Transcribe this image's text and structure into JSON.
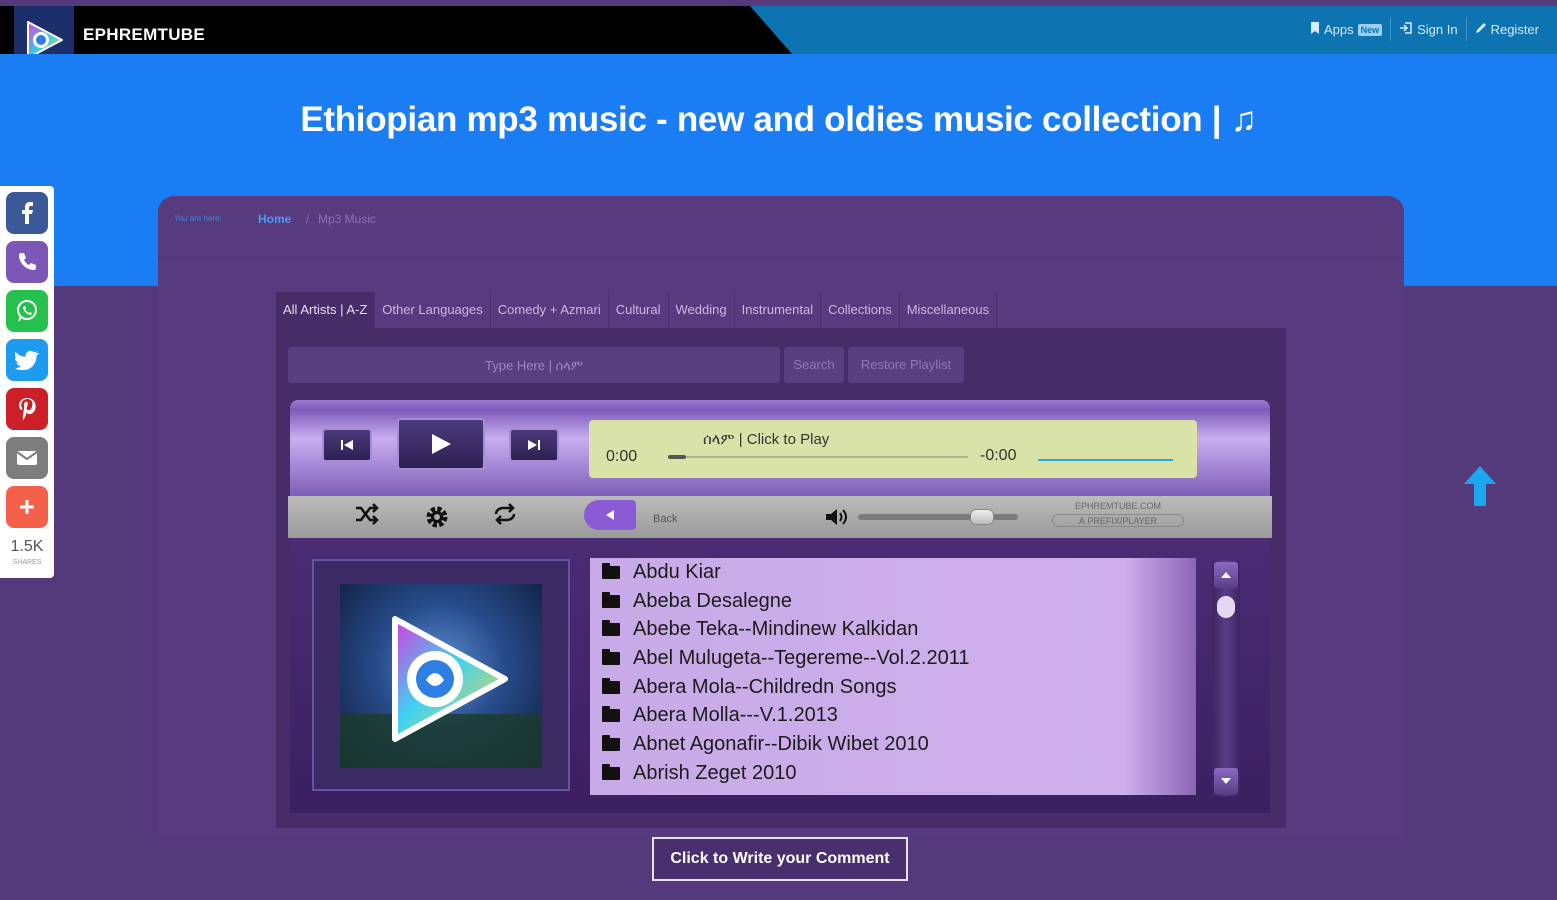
{
  "header": {
    "brand": "EPHREMTUBE",
    "nav": [
      {
        "label": "Apps",
        "badge": "New"
      },
      {
        "label": "Sign In"
      },
      {
        "label": "Register"
      }
    ]
  },
  "hero": {
    "title": "Ethiopian mp3 music - new and oldies music collection | ♫"
  },
  "breadcrumb": {
    "prefix": "You are here:",
    "home": "Home",
    "separator": "/",
    "current": "Mp3 Music"
  },
  "tabs": [
    "All Artists | A-Z",
    "Other Languages",
    "Comedy + Azmari",
    "Cultural",
    "Wedding",
    "Instrumental",
    "Collections",
    "Miscellaneous"
  ],
  "search": {
    "placeholder": "Type Here | ሰላም",
    "search_label": "Search",
    "restore_label": "Restore Playlist"
  },
  "player": {
    "time_elapsed": "0:00",
    "time_remaining": "-0:00",
    "now_playing": "ሰላም | Click to Play",
    "back_label": "Back",
    "site_tag": "EPHREMTUBE.COM",
    "site_tag_sub": "A.PREFIX/PLAYER",
    "volume": 0.75,
    "icons": {
      "prev": "skip-back-icon",
      "play": "play-icon",
      "next": "skip-forward-icon",
      "shuffle": "shuffle-icon",
      "settings": "gear-icon",
      "repeat": "repeat-icon",
      "volume": "speaker-icon"
    }
  },
  "playlist": [
    "Abdu Kiar",
    "Abeba Desalegne",
    "Abebe Teka--Mindinew Kalkidan",
    "Abel Mulugeta--Tegereme--Vol.2.2011",
    "Abera Mola--Childredn Songs",
    "Abera Molla---V.1.2013",
    "Abnet Agonafir--Dibik Wibet 2010",
    "Abrish Zeget 2010"
  ],
  "comment_button": "Click to Write your Comment",
  "social": {
    "share_count": "1.5K",
    "share_label": "SHARES",
    "buttons": [
      {
        "name": "facebook",
        "color": "#3b5998"
      },
      {
        "name": "viber",
        "color": "#7d57b8"
      },
      {
        "name": "whatsapp",
        "color": "#25c04d"
      },
      {
        "name": "twitter",
        "color": "#1d9bf0"
      },
      {
        "name": "pinterest",
        "color": "#cb2027"
      },
      {
        "name": "email",
        "color": "#7d7d7d"
      },
      {
        "name": "more",
        "color": "#f5604a"
      }
    ]
  },
  "colors": {
    "accent": "#1a7df3",
    "panel": "#583a7f",
    "topbar": "#0d73b1"
  }
}
